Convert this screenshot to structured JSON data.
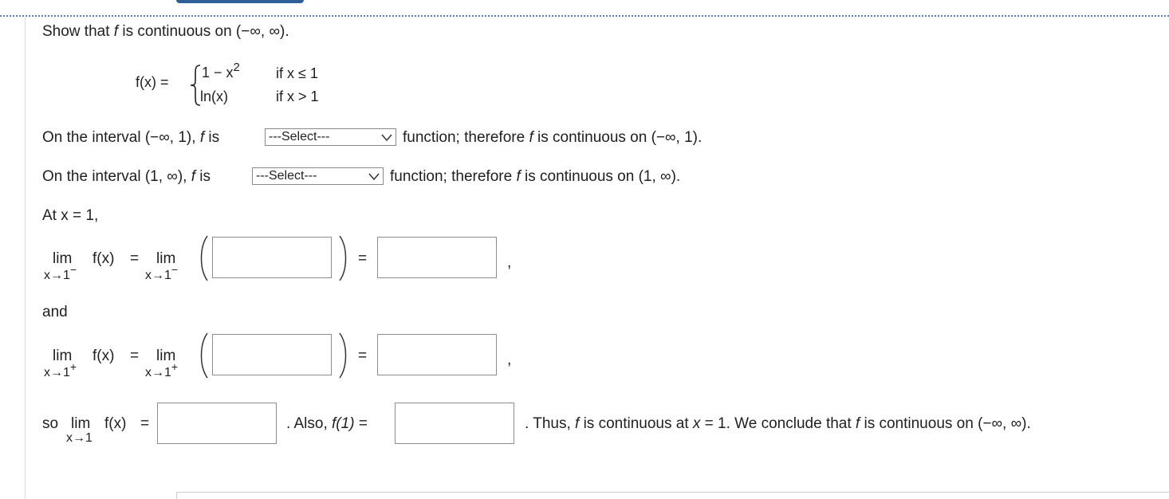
{
  "prompt": "Show that",
  "prompt_f": "f",
  "prompt_rest": "is continuous on (−∞, ∞).",
  "func": {
    "lhs": "f(x) =",
    "case1_expr": "1 − x",
    "case1_exp": "2",
    "case1_cond": "if x ≤ 1",
    "case2_expr": "ln(x)",
    "case2_cond": "if x > 1"
  },
  "line1": {
    "pre": "On the interval (−∞, 1),",
    "f": "f",
    "is": "is",
    "select": "---Select---",
    "post_a": "function; therefore",
    "f2": "f",
    "post_b": "is continuous on (−∞, 1)."
  },
  "line2": {
    "pre": "On the interval (1, ∞),",
    "f": "f",
    "is": "is",
    "select": "---Select---",
    "post_a": "function; therefore",
    "f2": "f",
    "post_b": "is continuous on (1, ∞)."
  },
  "at": "At x = 1,",
  "limit_left": {
    "lim": "lim",
    "fx": "f(x)",
    "eq": "=",
    "lim2": "lim",
    "sub": "x→1",
    "supm": "−",
    "eq2": "=",
    "comma": ","
  },
  "and": "and",
  "limit_right": {
    "lim": "lim",
    "fx": "f(x)",
    "eq": "=",
    "lim2": "lim",
    "sub": "x→1",
    "supm": "+",
    "eq2": "=",
    "comma": ","
  },
  "conclusion": {
    "so": "so",
    "lim": "lim",
    "fx": "f(x)",
    "eq": "=",
    "sub": "x→1",
    "also": ". Also,",
    "f1": "f(1)",
    "eq2": "=",
    "thus_a": ". Thus,",
    "f": "f",
    "thus_b": "is continuous at",
    "x": "x",
    "thus_c": "= 1. We conclude that",
    "f2": "f",
    "thus_d": "is continuous on (−∞, ∞)."
  }
}
